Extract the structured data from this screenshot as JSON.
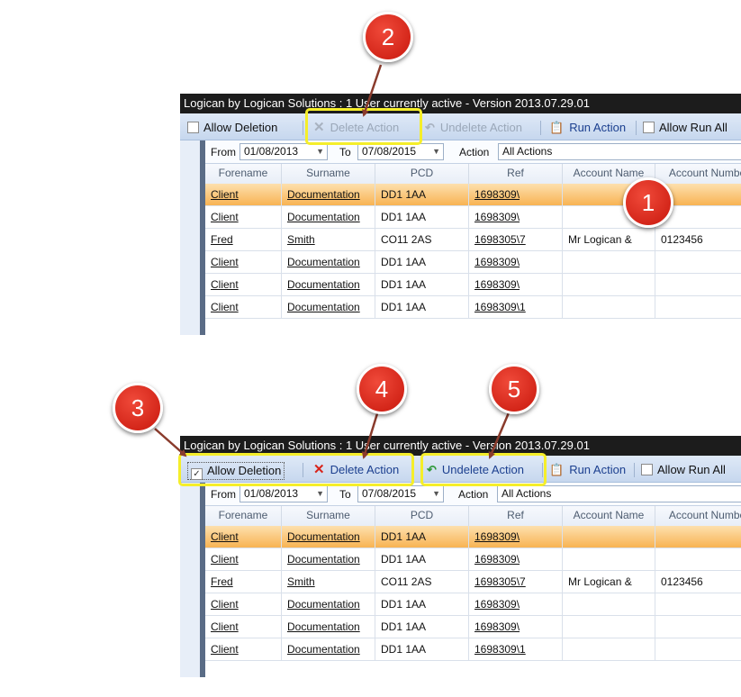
{
  "app_title": "Logican by Logican Solutions : 1 User currently active - Version 2013.07.29.01",
  "toolbar": {
    "allow_deletion": "Allow Deletion",
    "delete_action": "Delete Action",
    "undelete_action": "Undelete Action",
    "run_action": "Run Action",
    "allow_run_all": "Allow Run All"
  },
  "filter": {
    "from_label": "From",
    "from_value": "01/08/2013",
    "to_label": "To",
    "to_value": "07/08/2015",
    "action_label": "Action",
    "action_value": "All Actions"
  },
  "columns": [
    "Forename",
    "Surname",
    "PCD",
    "Ref",
    "Account Name",
    "Account Number"
  ],
  "rows": [
    [
      "Client",
      "Documentation",
      "DD1 1AA",
      "1698309\\",
      "",
      ""
    ],
    [
      "Client",
      "Documentation",
      "DD1 1AA",
      "1698309\\",
      "",
      ""
    ],
    [
      "Fred",
      "Smith",
      "CO11 2AS",
      "1698305\\7",
      "Mr Logican &",
      "0123456"
    ],
    [
      "Client",
      "Documentation",
      "DD1 1AA",
      "1698309\\",
      "",
      ""
    ],
    [
      "Client",
      "Documentation",
      "DD1 1AA",
      "1698309\\",
      "",
      ""
    ],
    [
      "Client",
      "Documentation",
      "DD1 1AA",
      "1698309\\1",
      "",
      ""
    ]
  ],
  "callouts": [
    "1",
    "2",
    "3",
    "4",
    "5"
  ],
  "colors": {
    "callout": "#d8241a",
    "highlight": "#f5ee2a",
    "selected_row": "#f8b353",
    "titlebar": "#1c1c1c"
  },
  "icons": {
    "delete": "x-icon",
    "undelete": "undo-arrow-icon",
    "run": "clipboard-icon",
    "dropdown": "chevron-down-icon"
  }
}
